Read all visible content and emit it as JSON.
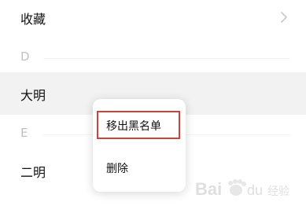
{
  "contacts": {
    "favorites_label": "收藏",
    "sections": [
      {
        "letter": "D",
        "names": [
          "大明"
        ]
      },
      {
        "letter": "E",
        "names": [
          "二明"
        ]
      }
    ]
  },
  "context_menu": {
    "items": [
      {
        "label": "移出黑名单"
      },
      {
        "label": "删除"
      }
    ]
  },
  "icons": {
    "favorites_chevron": "chevron-right-icon"
  },
  "colors": {
    "highlight_border": "#d43f3a",
    "section_letter": "#c0c0c8",
    "selected_row_bg": "#f2f2f2"
  },
  "watermark": {
    "brand": "Bai du",
    "sub": "经验"
  }
}
